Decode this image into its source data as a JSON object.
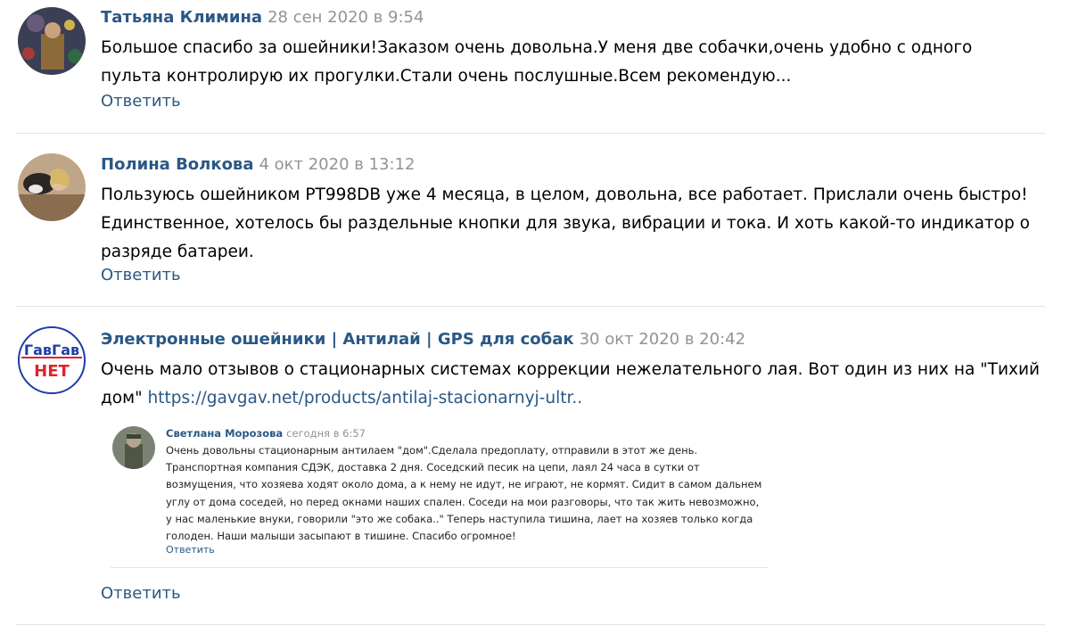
{
  "comments": [
    {
      "author": "Татьяна Климина",
      "date": "28 сен 2020 в 9:54",
      "lines": [
        "Большое спасибо за ошейники!Заказом очень довольна.У меня две собачки,очень удобно с одного",
        "пульта контролирую их прогулки.Стали очень послушные.Всем рекомендую..."
      ],
      "reply": "Ответить"
    },
    {
      "author": "Полина Волкова",
      "date": "4 окт 2020 в 13:12",
      "lines": [
        "Пользуюсь ошейником PT998DB уже 4 месяца, в целом, довольна, все работает. Прислали очень быстро!",
        "Единственное, хотелось бы раздельные кнопки для звука, вибрации и тока. И хоть какой-то индикатор о",
        "разряде батареи."
      ],
      "reply": "Ответить"
    },
    {
      "author": "Электронные ошейники | Антилай | GPS для собак",
      "date": "30 окт 2020 в 20:42",
      "line1": "Очень мало отзывов о стационарных системах коррекции нежелательного лая. Вот один из них на \"Тихий",
      "line2_prefix": "дом\"",
      "link": "https://gavgav.net/products/antilaj-stacionarnyj-ultr..",
      "logo_top": "ГавГав",
      "logo_bottom": "НЕТ",
      "reply": "Ответить"
    }
  ],
  "embedded": {
    "author": "Светлана Морозова",
    "date": "сегодня в 6:57",
    "lines": [
      "Очень довольны стационарным антилаем \"дом\".Сделала предоплату, отправили в этот же день.",
      "Транспортная компания СДЭК, доставка 2 дня. Соседский песик на цепи, лаял 24 часа в сутки от",
      "возмущения, что хозяева ходят около дома, а к нему не идут, не играют, не кормят. Сидит в самом дальнем",
      "углу от дома соседей, но перед окнами наших спален. Соседи на мои разговоры, что так жить невозможно,",
      "у нас маленькие внуки, говорили \"это же собака..\" Теперь наступила тишина, лает на хозяев только когда",
      "голоден. Наши малыши засыпают в тишине. Спасибо огромное!"
    ],
    "reply": "Ответить"
  },
  "colors": {
    "link": "#2a5885",
    "date": "#939393",
    "divider": "#e1e3e6",
    "logo_blue": "#1d3fa8",
    "logo_red": "#e3202a"
  }
}
